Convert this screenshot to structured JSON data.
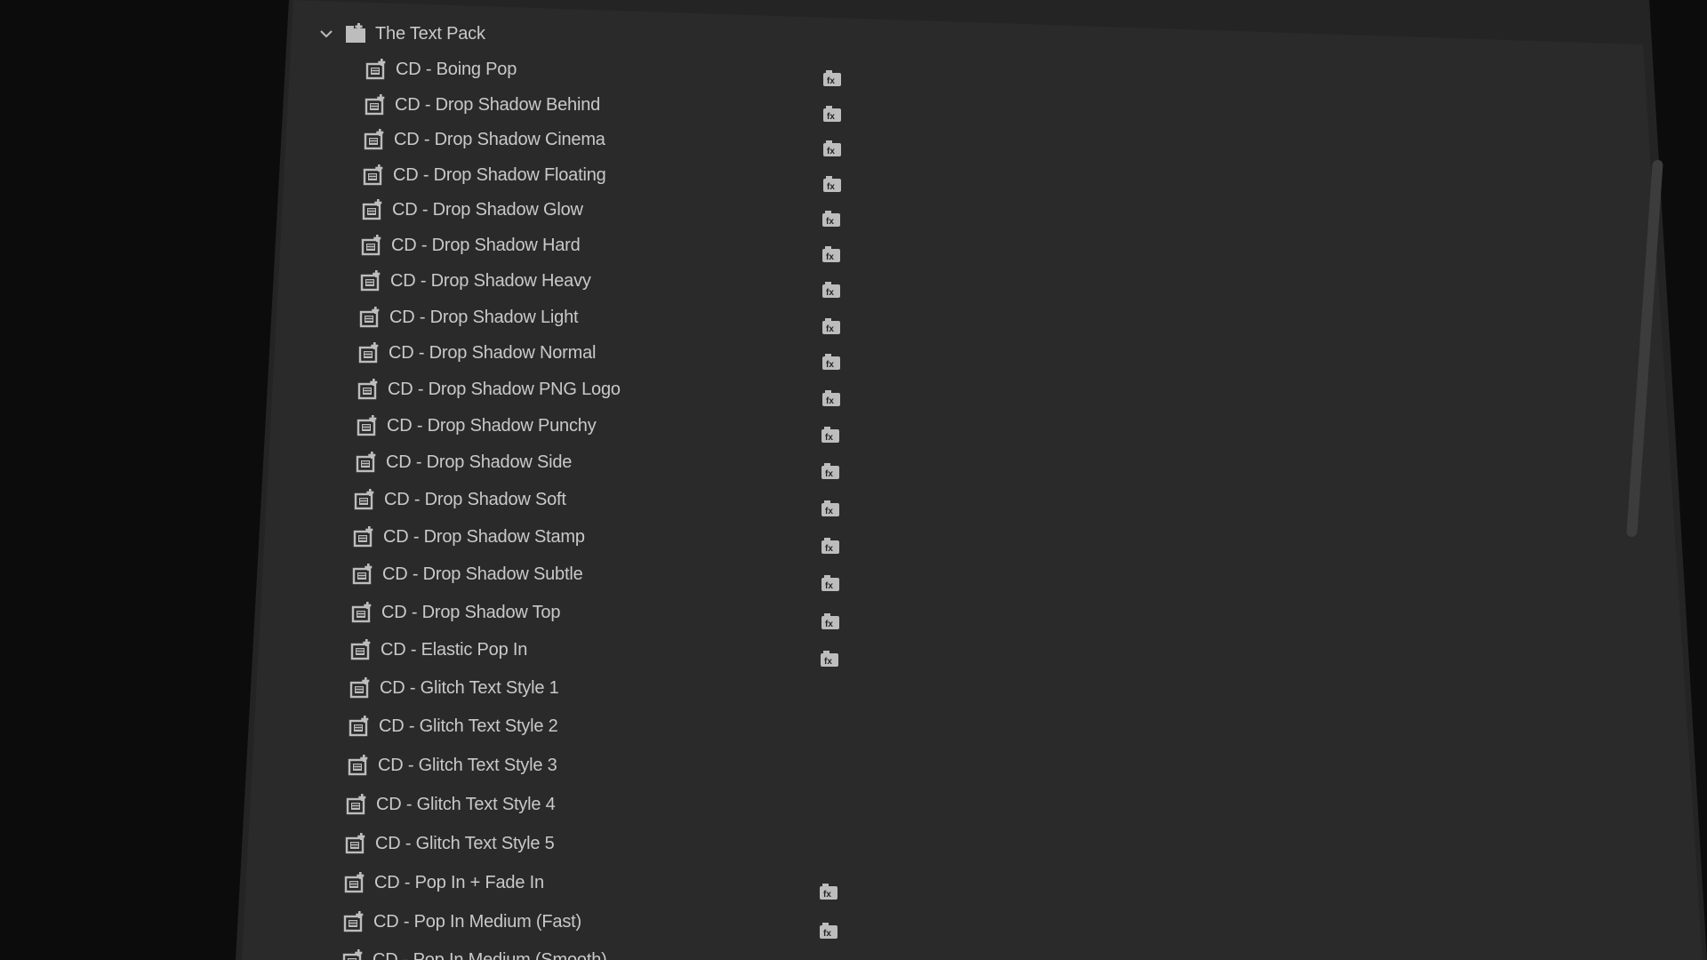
{
  "folder": {
    "label": "The Text Pack",
    "chevron_icon": "chevron-down-icon",
    "icon": "bin-folder-icon"
  },
  "items": [
    {
      "label": "CD - Boing Pop",
      "badge": true
    },
    {
      "label": "CD - Drop Shadow Behind",
      "badge": true
    },
    {
      "label": "CD - Drop Shadow Cinema",
      "badge": true
    },
    {
      "label": "CD - Drop Shadow Floating",
      "badge": true
    },
    {
      "label": "CD - Drop Shadow Glow",
      "badge": true
    },
    {
      "label": "CD - Drop Shadow Hard",
      "badge": true
    },
    {
      "label": "CD - Drop Shadow Heavy",
      "badge": true
    },
    {
      "label": "CD - Drop Shadow Light",
      "badge": true
    },
    {
      "label": "CD - Drop Shadow Normal",
      "badge": true
    },
    {
      "label": "CD - Drop Shadow PNG Logo",
      "badge": true
    },
    {
      "label": "CD - Drop Shadow Punchy",
      "badge": true
    },
    {
      "label": "CD - Drop Shadow Side",
      "badge": true
    },
    {
      "label": "CD - Drop Shadow Soft",
      "badge": true
    },
    {
      "label": "CD - Drop Shadow Stamp",
      "badge": true
    },
    {
      "label": "CD - Drop Shadow Subtle",
      "badge": true
    },
    {
      "label": "CD - Drop Shadow Top",
      "badge": true
    },
    {
      "label": "CD - Elastic Pop In",
      "badge": true
    },
    {
      "label": "CD - Glitch Text Style 1",
      "badge": false
    },
    {
      "label": "CD - Glitch Text Style 2",
      "badge": false
    },
    {
      "label": "CD - Glitch Text Style 3",
      "badge": false
    },
    {
      "label": "CD - Glitch Text Style 4",
      "badge": false
    },
    {
      "label": "CD - Glitch Text Style 5",
      "badge": false
    },
    {
      "label": "CD - Pop In + Fade In",
      "badge": true
    },
    {
      "label": "CD - Pop In Medium (Fast)",
      "badge": true
    },
    {
      "label": "CD - Pop In Medium (Smooth)",
      "badge": true
    }
  ],
  "icons": {
    "item": "preset-item-icon",
    "badge": "effect-badge-icon"
  },
  "colors": {
    "background": "#0c0c0c",
    "panel": "#242424",
    "text": "#c9c9c9",
    "icon": "#bdbdbd",
    "scrollbar": "#3c3c3c"
  }
}
